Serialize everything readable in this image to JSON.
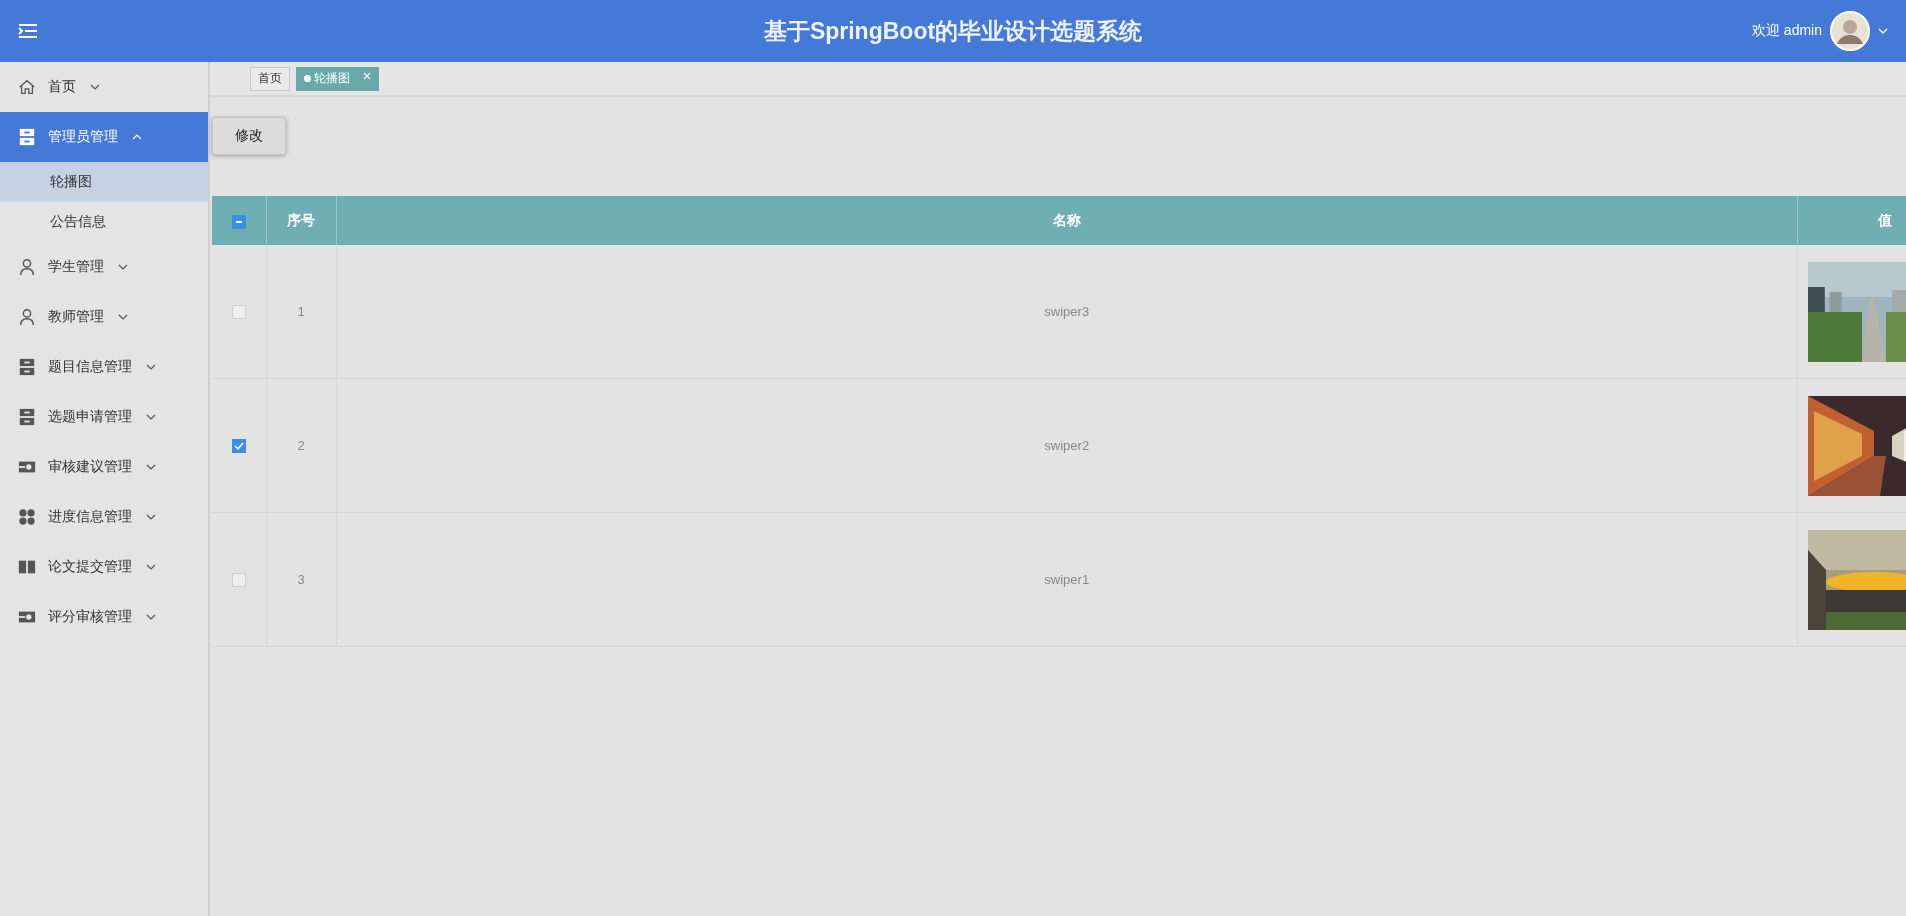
{
  "header": {
    "title": "基于SpringBoot的毕业设计选题系统",
    "greeting": "欢迎 admin"
  },
  "sidebar": {
    "items": [
      {
        "label": "首页",
        "kind": "home",
        "selected": false,
        "expanded": false
      },
      {
        "label": "管理员管理",
        "kind": "drawer",
        "selected": true,
        "expanded": true,
        "children": [
          {
            "label": "轮播图",
            "selected": true
          },
          {
            "label": "公告信息",
            "selected": false
          }
        ]
      },
      {
        "label": "学生管理",
        "kind": "person",
        "selected": false,
        "expanded": false
      },
      {
        "label": "教师管理",
        "kind": "person",
        "selected": false,
        "expanded": false
      },
      {
        "label": "题目信息管理",
        "kind": "drawer",
        "selected": false,
        "expanded": false
      },
      {
        "label": "选题申请管理",
        "kind": "drawer",
        "selected": false,
        "expanded": false
      },
      {
        "label": "审核建议管理",
        "kind": "camera",
        "selected": false,
        "expanded": false
      },
      {
        "label": "进度信息管理",
        "kind": "grid",
        "selected": false,
        "expanded": false
      },
      {
        "label": "论文提交管理",
        "kind": "book",
        "selected": false,
        "expanded": false
      },
      {
        "label": "评分审核管理",
        "kind": "camera",
        "selected": false,
        "expanded": false
      }
    ]
  },
  "tabs": [
    {
      "label": "首页",
      "selected": false
    },
    {
      "label": "轮播图",
      "selected": true
    }
  ],
  "toolbar": {
    "button": "修改"
  },
  "table": {
    "indeterminate": true,
    "columns": [
      "序号",
      "名称",
      "值"
    ],
    "rows": [
      {
        "checked": false,
        "index": "1",
        "name": "swiper3"
      },
      {
        "checked": true,
        "index": "2",
        "name": "swiper2"
      },
      {
        "checked": false,
        "index": "3",
        "name": "swiper1"
      }
    ]
  }
}
